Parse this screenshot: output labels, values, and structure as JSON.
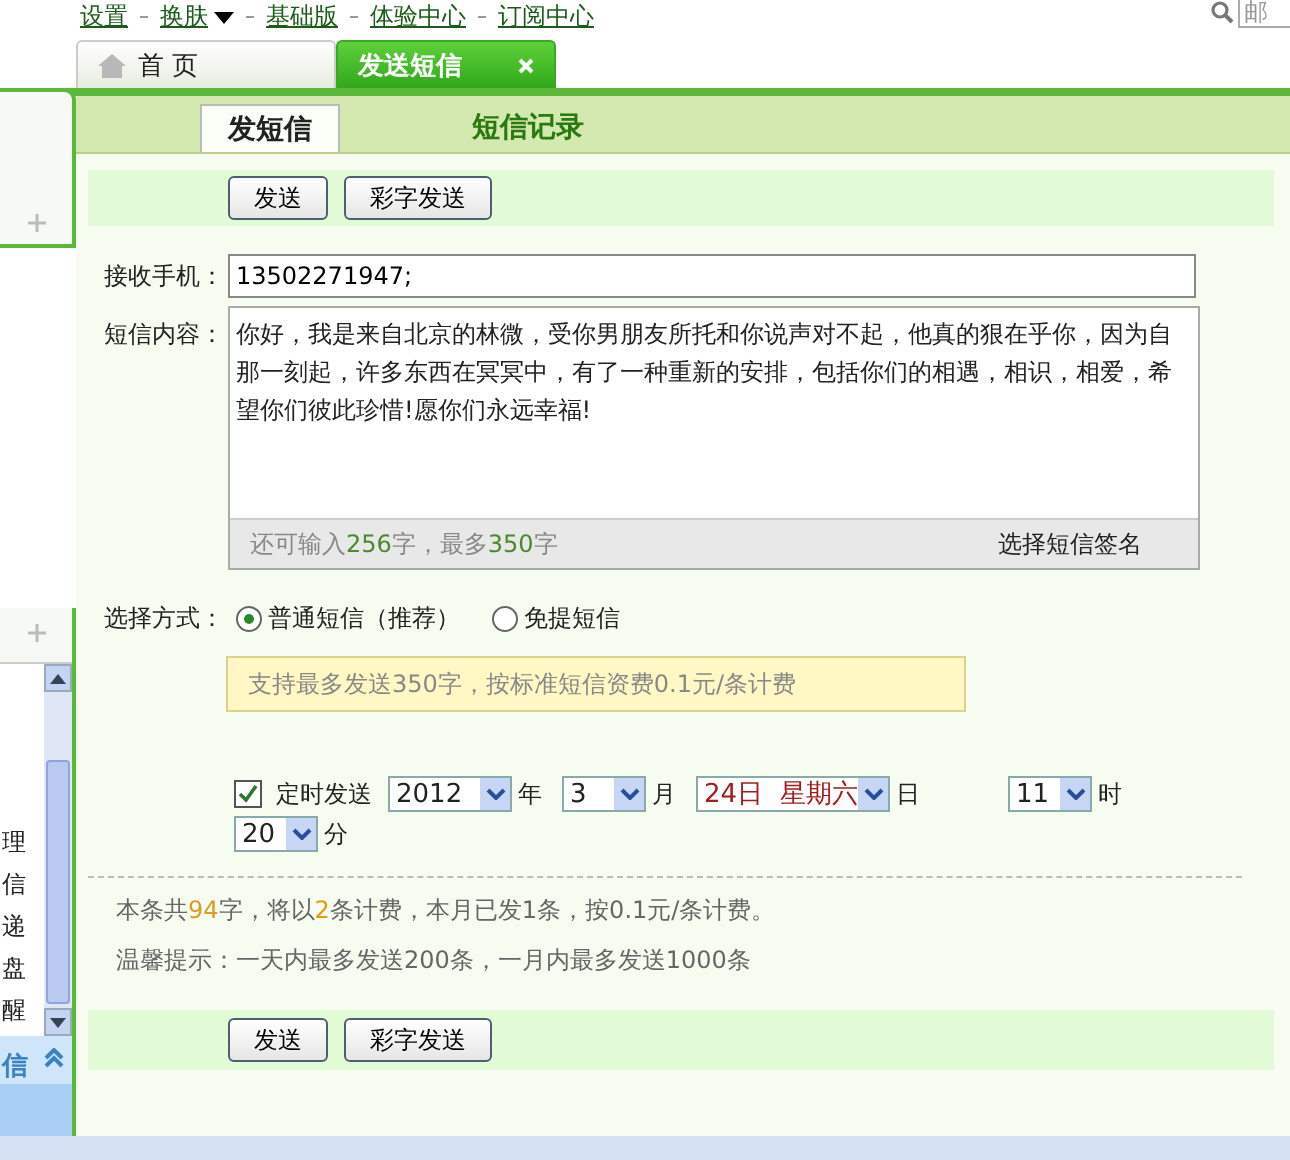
{
  "top_links": [
    {
      "label": "设置",
      "has_menu": false
    },
    {
      "label": "换肤",
      "has_menu": true
    },
    {
      "label": "基础版",
      "has_menu": false
    },
    {
      "label": "体验中心",
      "has_menu": false
    },
    {
      "label": "订阅中心",
      "has_menu": false
    }
  ],
  "search": {
    "placeholder": "邮"
  },
  "tabs": [
    {
      "label": "首 页",
      "selected": false,
      "closable": false
    },
    {
      "label": "发送短信",
      "selected": true,
      "closable": true
    }
  ],
  "sidebar": {
    "items": [
      "理",
      "信",
      "递",
      "盘",
      "醒"
    ],
    "section": "信"
  },
  "subtabs": [
    {
      "label": "发短信",
      "selected": true
    },
    {
      "label": "短信记录",
      "selected": false
    }
  ],
  "toolbar_buttons": [
    "发送",
    "彩字发送"
  ],
  "recipient": {
    "label": "接收手机：",
    "value": "13502271947;"
  },
  "content": {
    "label": "短信内容：",
    "value": "你好，我是来自北京的林微，受你男朋友所托和你说声对不起，他真的狠在乎你，因为自那一刻起，许多东西在冥冥中，有了一种重新的安排，包括你们的相遇，相识，相爱，希望你们彼此珍惜!愿你们永远幸福!",
    "counter": [
      {
        "text": "还可输入",
        "highlight": false
      },
      {
        "text": "256",
        "highlight": true
      },
      {
        "text": "字，最多",
        "highlight": false
      },
      {
        "text": "350",
        "highlight": true
      },
      {
        "text": "字",
        "highlight": false
      }
    ],
    "signature_link": "选择短信签名"
  },
  "method": {
    "label": "选择方式：",
    "options": [
      {
        "label": "普通短信（推荐）",
        "selected": true
      },
      {
        "label": "免提短信",
        "selected": false
      }
    ],
    "hint": "支持最多发送350字，按标准短信资费0.1元/条计费"
  },
  "schedule": {
    "checked": true,
    "label": "定时发送",
    "fields": [
      {
        "value": "2012",
        "unit": "年",
        "highlight": false
      },
      {
        "value": "3",
        "unit": "月",
        "highlight": false
      },
      {
        "value": "24日  星期六",
        "unit": "日",
        "highlight": true
      },
      {
        "value": "11",
        "unit": "时",
        "highlight": false
      },
      {
        "value": "20",
        "unit": "分",
        "highlight": false
      }
    ]
  },
  "summary": [
    {
      "text": "本条共",
      "highlight": false
    },
    {
      "text": "94",
      "highlight": true
    },
    {
      "text": "字，将以",
      "highlight": false
    },
    {
      "text": "2",
      "highlight": true
    },
    {
      "text": "条计费，本月已发1条，按0.1元/条计费。",
      "highlight": false
    }
  ],
  "tip": "温馨提示：一天内最多发送200条，一月内最多发送1000条",
  "bottom_buttons": [
    "发送",
    "彩字发送"
  ]
}
